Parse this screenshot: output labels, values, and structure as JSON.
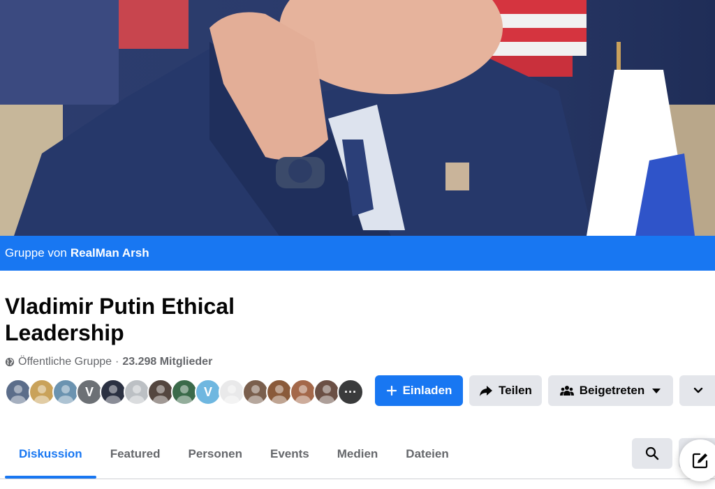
{
  "group": {
    "byline_prefix": "Gruppe von",
    "owner": "RealMan Arsh",
    "name": "Vladimir Putin Ethical Leadership",
    "privacy": "Öffentliche Gruppe",
    "separator": "·",
    "member_count": "23.298 Mitglieder"
  },
  "avatars": [
    {
      "initial": "",
      "color": "#5b6d8a"
    },
    {
      "initial": "",
      "color": "#c9a25a"
    },
    {
      "initial": "",
      "color": "#6b93b0"
    },
    {
      "initial": "V",
      "color": "#6c7075"
    },
    {
      "initial": "",
      "color": "#2b3142"
    },
    {
      "initial": "",
      "color": "#bcc0c4"
    },
    {
      "initial": "",
      "color": "#54463f"
    },
    {
      "initial": "",
      "color": "#3b6a4a"
    },
    {
      "initial": "V",
      "color": "#6fb7e0"
    },
    {
      "initial": "",
      "color": "#e9e9ea"
    },
    {
      "initial": "",
      "color": "#7a5f4d"
    },
    {
      "initial": "",
      "color": "#8a5a3a"
    },
    {
      "initial": "",
      "color": "#a4684a"
    },
    {
      "initial": "",
      "color": "#6b5045"
    },
    {
      "initial": "···",
      "color": "#3a3b3c"
    }
  ],
  "actions": {
    "invite": "Einladen",
    "share": "Teilen",
    "joined": "Beigetreten"
  },
  "tabs": [
    {
      "label": "Diskussion",
      "active": true
    },
    {
      "label": "Featured",
      "active": false
    },
    {
      "label": "Personen",
      "active": false
    },
    {
      "label": "Events",
      "active": false
    },
    {
      "label": "Medien",
      "active": false
    },
    {
      "label": "Dateien",
      "active": false
    }
  ],
  "colors": {
    "accent": "#1877f2",
    "button_gray": "#e4e6eb",
    "text_secondary": "#65676b"
  },
  "icons": {
    "privacy": "globe-icon",
    "invite": "plus-icon",
    "share": "share-arrow-icon",
    "joined": "people-icon",
    "dropdown": "caret-down-icon",
    "more": "chevron-down-icon",
    "search": "search-icon",
    "compose": "compose-icon"
  }
}
